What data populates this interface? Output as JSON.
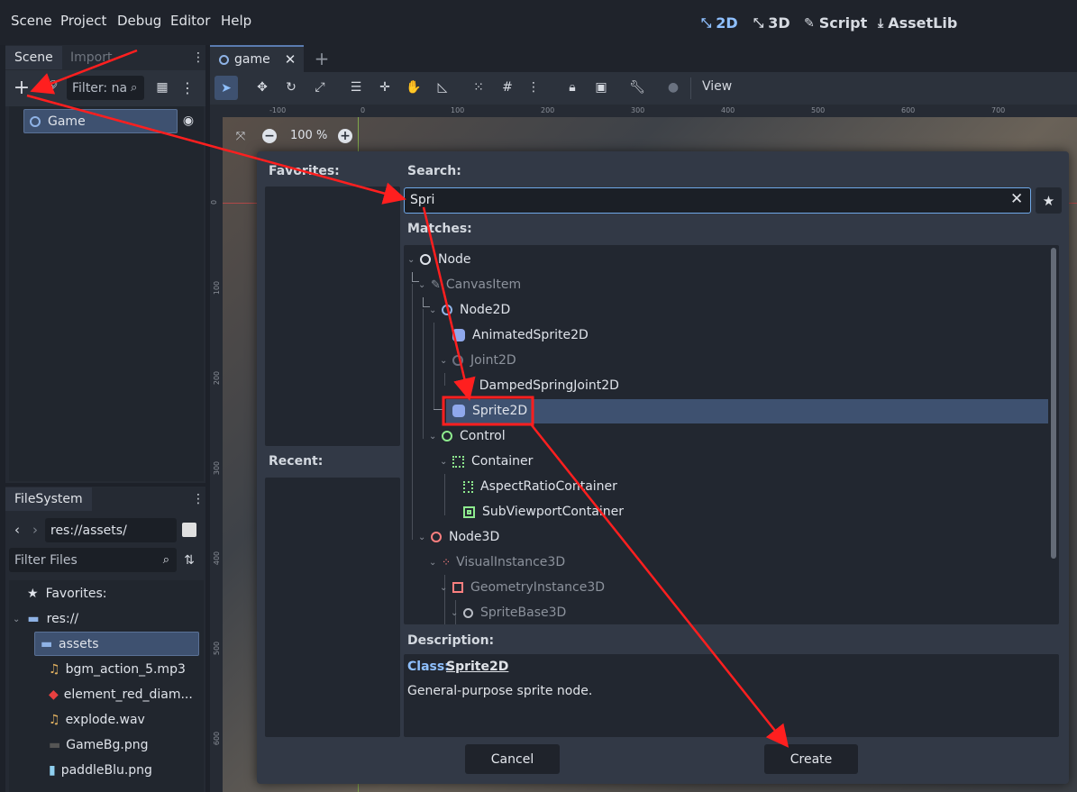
{
  "menubar": {
    "items": [
      "Scene",
      "Project",
      "Debug",
      "Editor",
      "Help"
    ],
    "modes": [
      {
        "label": "2D",
        "icon": "2d-icon",
        "active": true
      },
      {
        "label": "3D",
        "icon": "3d-icon",
        "active": false
      },
      {
        "label": "Script",
        "icon": "script-icon",
        "active": false
      },
      {
        "label": "AssetLib",
        "icon": "assetlib-icon",
        "active": false
      }
    ]
  },
  "scene_dock": {
    "tabs": [
      "Scene",
      "Import"
    ],
    "filter_placeholder": "Filter: na",
    "root_node": "Game"
  },
  "filesystem": {
    "tab": "FileSystem",
    "path": "res://assets/",
    "filter_placeholder": "Filter Files",
    "items": [
      {
        "label": "Favorites:"
      },
      {
        "label": "res://"
      },
      {
        "label": "assets"
      },
      {
        "label": "bgm_action_5.mp3"
      },
      {
        "label": "element_red_diam..."
      },
      {
        "label": "explode.wav"
      },
      {
        "label": "GameBg.png"
      },
      {
        "label": "paddleBlu.png"
      }
    ]
  },
  "editor": {
    "tab": "game",
    "zoom": "100 %",
    "view_menu": "View",
    "ruler_top": [
      "-100",
      "0",
      "100",
      "200",
      "300",
      "400",
      "500",
      "600",
      "700"
    ],
    "ruler_left": [
      "0",
      "100",
      "200",
      "300",
      "400",
      "500",
      "600"
    ]
  },
  "dialog": {
    "favorites_label": "Favorites:",
    "recent_label": "Recent:",
    "search_label": "Search:",
    "search_value": "Spri",
    "matches_label": "Matches:",
    "tree": [
      {
        "label": "Node",
        "dim": false,
        "icon": "node-icon"
      },
      {
        "label": "CanvasItem",
        "dim": true,
        "icon": "canvasitem-icon"
      },
      {
        "label": "Node2D",
        "dim": false,
        "icon": "node2d-icon"
      },
      {
        "label": "AnimatedSprite2D",
        "dim": false,
        "icon": "animatedsprite2d-icon"
      },
      {
        "label": "Joint2D",
        "dim": true,
        "icon": "joint2d-icon"
      },
      {
        "label": "DampedSpringJoint2D",
        "dim": false,
        "icon": "dampedspringjoint2d-icon"
      },
      {
        "label": "Sprite2D",
        "dim": false,
        "icon": "sprite2d-icon",
        "selected": true
      },
      {
        "label": "Control",
        "dim": false,
        "icon": "control-icon"
      },
      {
        "label": "Container",
        "dim": false,
        "icon": "container-icon"
      },
      {
        "label": "AspectRatioContainer",
        "dim": false,
        "icon": "aspectratiocontainer-icon"
      },
      {
        "label": "SubViewportContainer",
        "dim": false,
        "icon": "subviewportcontainer-icon"
      },
      {
        "label": "Node3D",
        "dim": false,
        "icon": "node3d-icon"
      },
      {
        "label": "VisualInstance3D",
        "dim": true,
        "icon": "visualinstance3d-icon"
      },
      {
        "label": "GeometryInstance3D",
        "dim": true,
        "icon": "geometryinstance3d-icon"
      },
      {
        "label": "SpriteBase3D",
        "dim": true,
        "icon": "spritebase3d-icon"
      }
    ],
    "description_label": "Description:",
    "class_prefix": "Class:",
    "class_name": "Sprite2D",
    "description_text": "General-purpose sprite node.",
    "cancel_label": "Cancel",
    "create_label": "Create"
  },
  "colors": {
    "accent": "#8fc0ff",
    "selection": "#3e5170",
    "annotation": "#ff1f1f"
  }
}
